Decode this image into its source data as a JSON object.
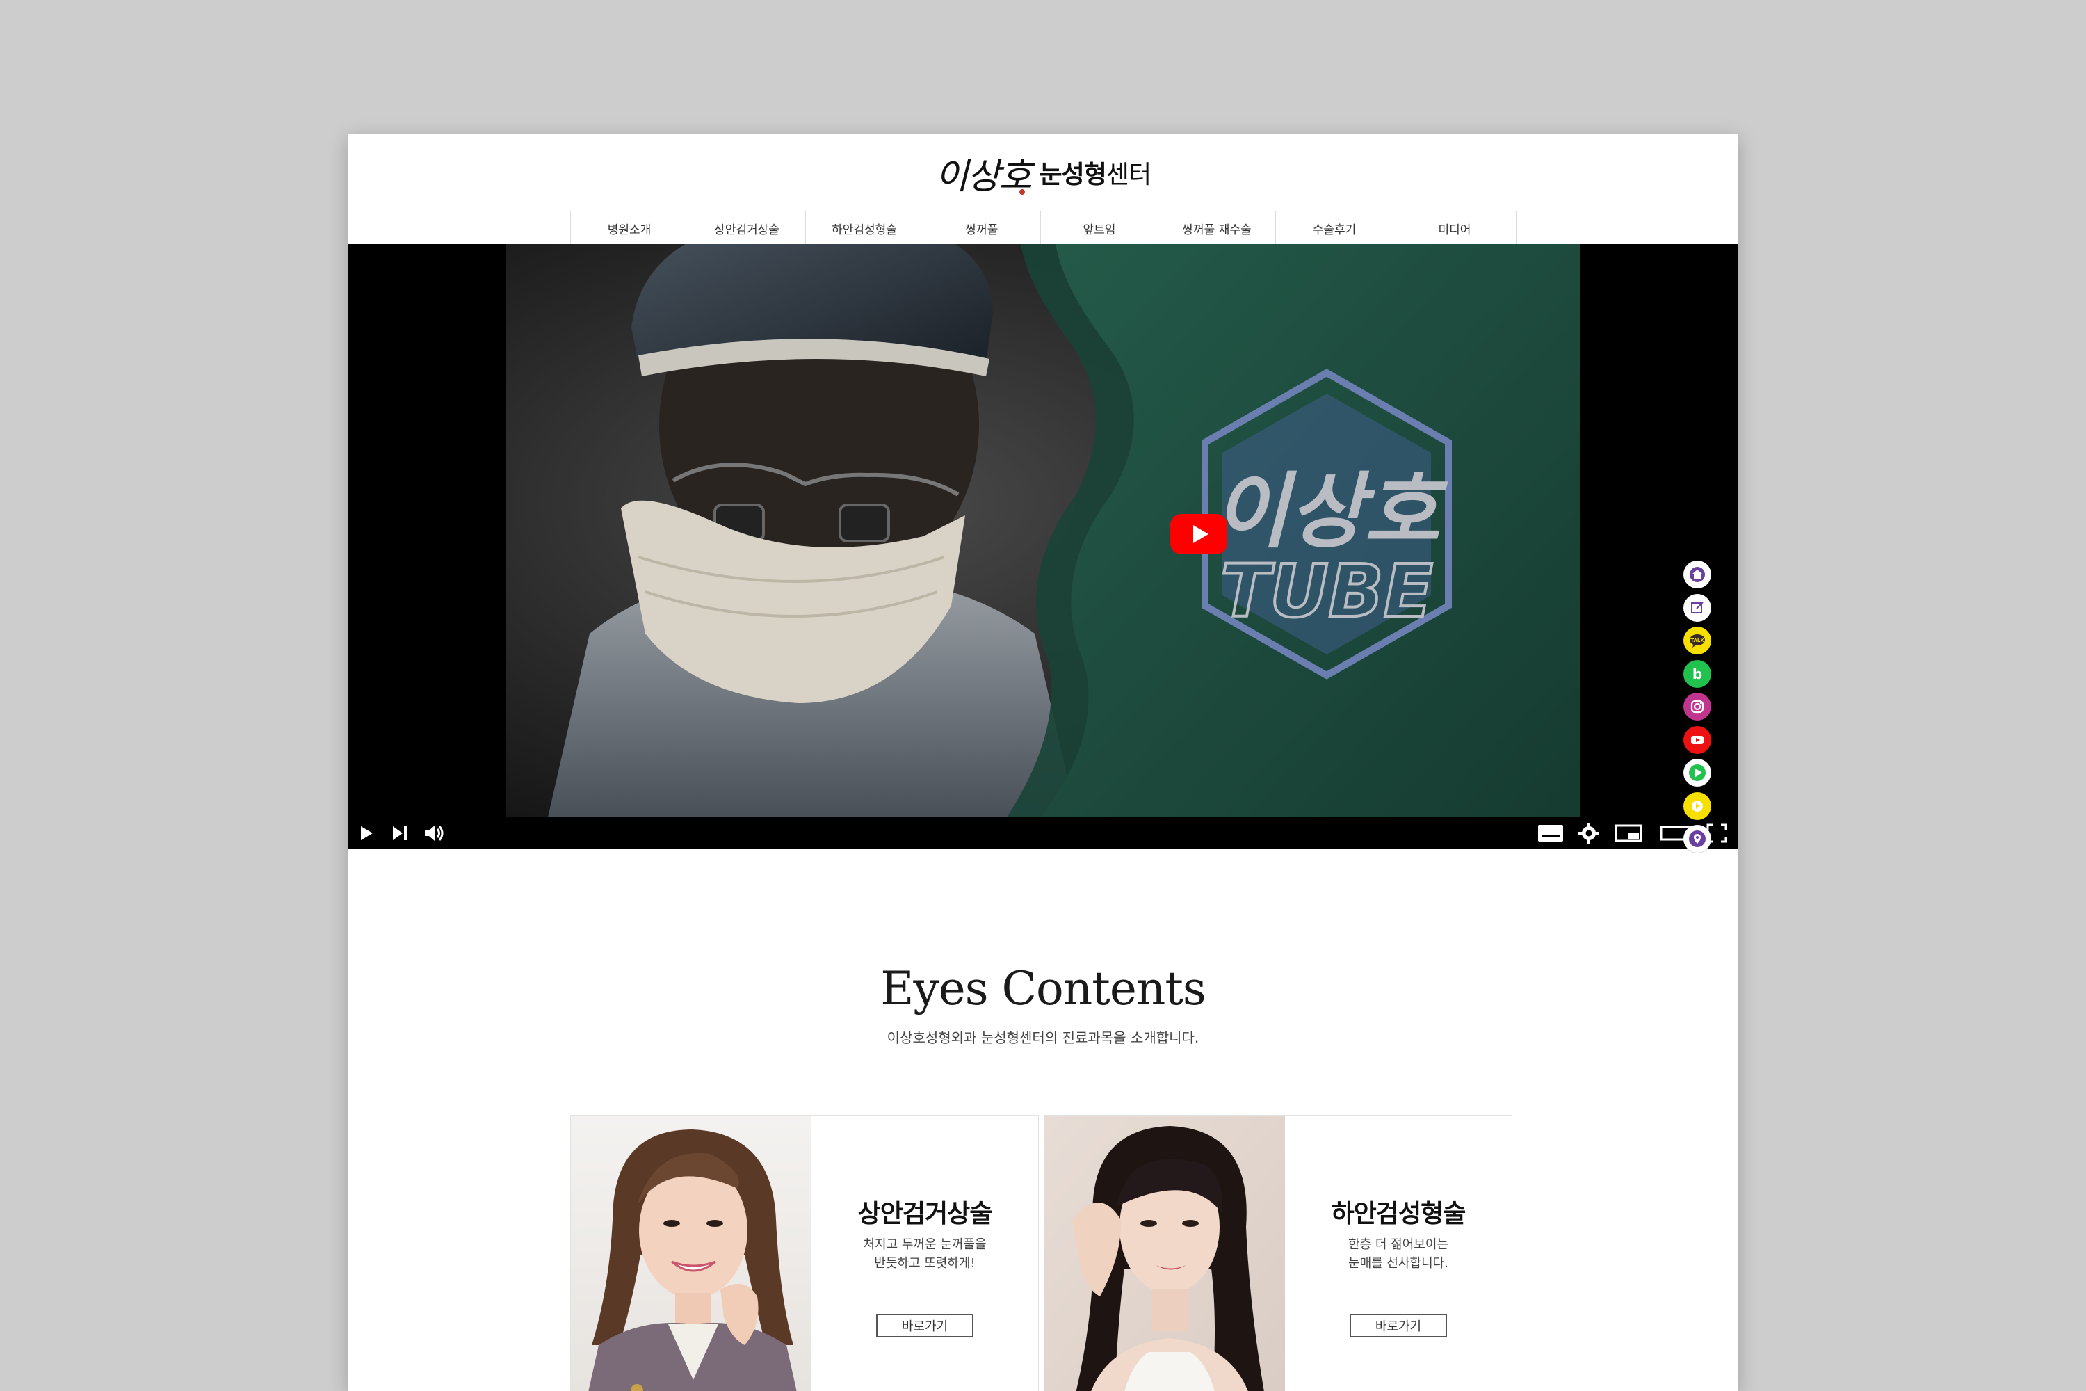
{
  "logo": {
    "mark": "이상호",
    "text_bold": "눈성형",
    "text_light": "센터"
  },
  "nav": {
    "items": [
      {
        "label": "병원소개"
      },
      {
        "label": "상안검거상술"
      },
      {
        "label": "하안검성형술"
      },
      {
        "label": "쌍꺼풀"
      },
      {
        "label": "앞트임"
      },
      {
        "label": "쌍꺼풀 재수술"
      },
      {
        "label": "수술후기"
      },
      {
        "label": "미디어"
      }
    ]
  },
  "video": {
    "thumbnail_title_line1": "이상호",
    "thumbnail_title_line2": "TUBE",
    "accent_color": "#ff0000",
    "panel_color": "#1e4a3c"
  },
  "social": {
    "items": [
      {
        "icon": "home-icon",
        "color": "#6a3fa0"
      },
      {
        "icon": "blog-icon",
        "color": "#6a3fa0"
      },
      {
        "icon": "kakao-talk-icon",
        "color": "#f7e000"
      },
      {
        "icon": "band-icon",
        "color": "#21c14e"
      },
      {
        "icon": "instagram-icon",
        "color": "#c1358f"
      },
      {
        "icon": "youtube-icon",
        "color": "#ee1111"
      },
      {
        "icon": "naver-tv-icon",
        "color": "#21c14e"
      },
      {
        "icon": "kakao-tv-icon",
        "color": "#f7e000"
      },
      {
        "icon": "location-pin-icon",
        "color": "#6a3fa0"
      }
    ]
  },
  "section": {
    "title": "Eyes Contents",
    "subtitle": "이상호성형외과 눈성형센터의 진료과목을 소개합니다."
  },
  "cards": [
    {
      "title": "상안검거상술",
      "desc_line1": "처지고 두꺼운 눈꺼풀을",
      "desc_line2": "반듯하고 또렷하게!",
      "button": "바로가기"
    },
    {
      "title": "하안검성형술",
      "desc_line1": "한층 더 젊어보이는",
      "desc_line2": "눈매를 선사합니다.",
      "button": "바로가기"
    }
  ]
}
